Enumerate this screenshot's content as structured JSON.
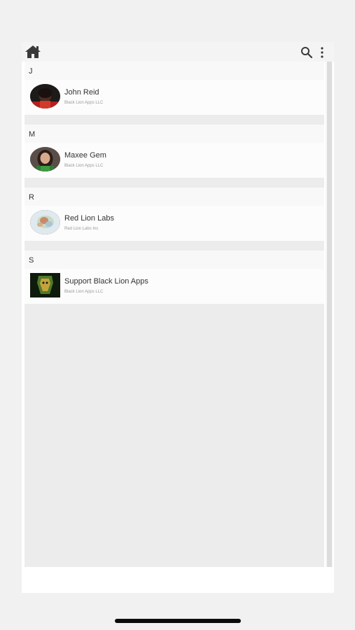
{
  "toolbar": {
    "home_icon": "home-icon",
    "search_icon": "search-icon",
    "more_icon": "more-vertical-icon"
  },
  "contacts": {
    "sections": [
      {
        "letter": "J",
        "items": [
          {
            "name": "John Reid",
            "company": "Black Lion Apps LLC",
            "avatar": "photo-man"
          }
        ]
      },
      {
        "letter": "M",
        "items": [
          {
            "name": "Maxee Gem",
            "company": "Black Lion Apps LLC",
            "avatar": "photo-woman"
          }
        ]
      },
      {
        "letter": "R",
        "items": [
          {
            "name": "Red Lion Labs",
            "company": "Red Lion Labs Inc",
            "avatar": "photo-lab"
          }
        ]
      },
      {
        "letter": "S",
        "items": [
          {
            "name": "Support Black Lion Apps",
            "company": "Black Lion Apps LLC",
            "avatar": "photo-lion-logo"
          }
        ]
      }
    ]
  },
  "colors": {
    "background": "#f1f1f1",
    "toolbar": "#f4f4f4",
    "list_background": "#ececec",
    "text": "#333333",
    "subtext": "#9a9a9a"
  }
}
